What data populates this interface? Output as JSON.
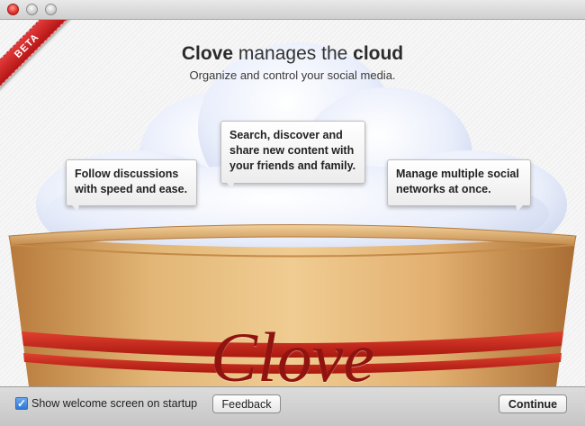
{
  "window": {
    "controls": [
      "close",
      "minimize",
      "zoom"
    ]
  },
  "ribbon": {
    "label": "BETA"
  },
  "header": {
    "title_brand": "Clove",
    "title_mid": " manages the ",
    "title_end": "cloud",
    "subtitle": "Organize and control your social media."
  },
  "bubbles": [
    {
      "text": "Follow discussions with speed and ease."
    },
    {
      "text": "Search, discover and share new content with your friends and family."
    },
    {
      "text": "Manage multiple social networks at once."
    }
  ],
  "illustration": {
    "bowl_label": "Clove",
    "colors": {
      "bowl": "#d8a665",
      "stripe": "#c8241c",
      "cloud": "#e6ecfb"
    }
  },
  "footer": {
    "checkbox_label": "Show welcome screen on startup",
    "checkbox_checked": true,
    "feedback_label": "Feedback",
    "continue_label": "Continue"
  }
}
